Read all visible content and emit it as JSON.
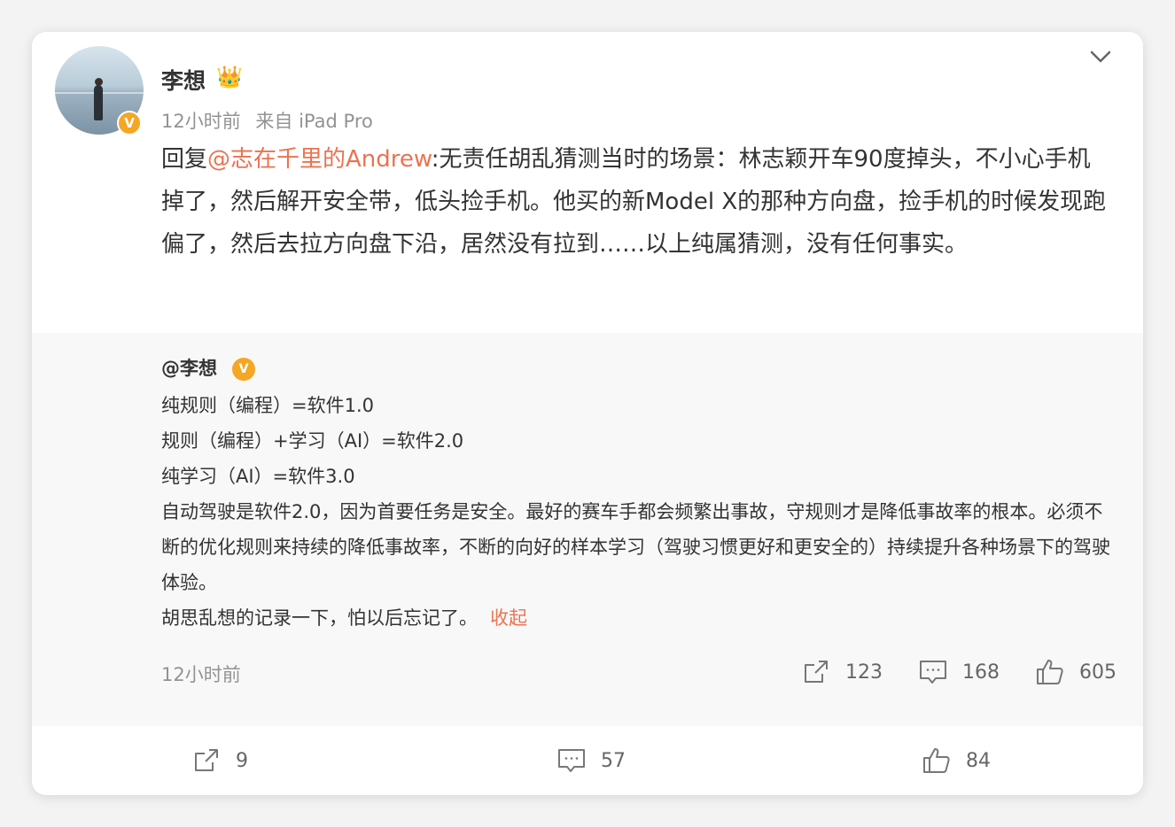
{
  "post": {
    "username": "李想",
    "crown_icon": "crown-icon",
    "verified_icon": "v-badge-icon",
    "time": "12小时前",
    "source": "来自 iPad Pro",
    "reply_prefix": "回复",
    "mention": "@志在千里的Andrew",
    "text": ":无责任胡乱猜测当时的场景：林志颖开车90度掉头，不小心手机掉了，然后解开安全带，低头捡手机。他买的新Model X的那种方向盘，捡手机的时候发现跑偏了，然后去拉方向盘下沿，居然没有拉到……以上纯属猜测，没有任何事实。"
  },
  "repost": {
    "author": "@李想",
    "badge": "V",
    "lines": [
      "纯规则（编程）=软件1.0",
      "规则（编程）+学习（AI）=软件2.0",
      "纯学习（AI）=软件3.0",
      "自动驾驶是软件2.0，因为首要任务是安全。最好的赛车手都会频繁出事故，守规则才是降低事故率的根本。必须不断的优化规则来持续的降低事故率，不断的向好的样本学习（驾驶习惯更好和更安全的）持续提升各种场景下的驾驶体验。",
      "胡思乱想的记录一下，怕以后忘记了。"
    ],
    "collapse_label": "收起",
    "time": "12小时前",
    "actions": {
      "share_count": "123",
      "comment_count": "168",
      "like_count": "605"
    }
  },
  "footer": {
    "share_count": "9",
    "comment_count": "57",
    "like_count": "84"
  },
  "colors": {
    "accent": "#eb7350",
    "verified": "#f5a623",
    "muted": "#939393"
  }
}
